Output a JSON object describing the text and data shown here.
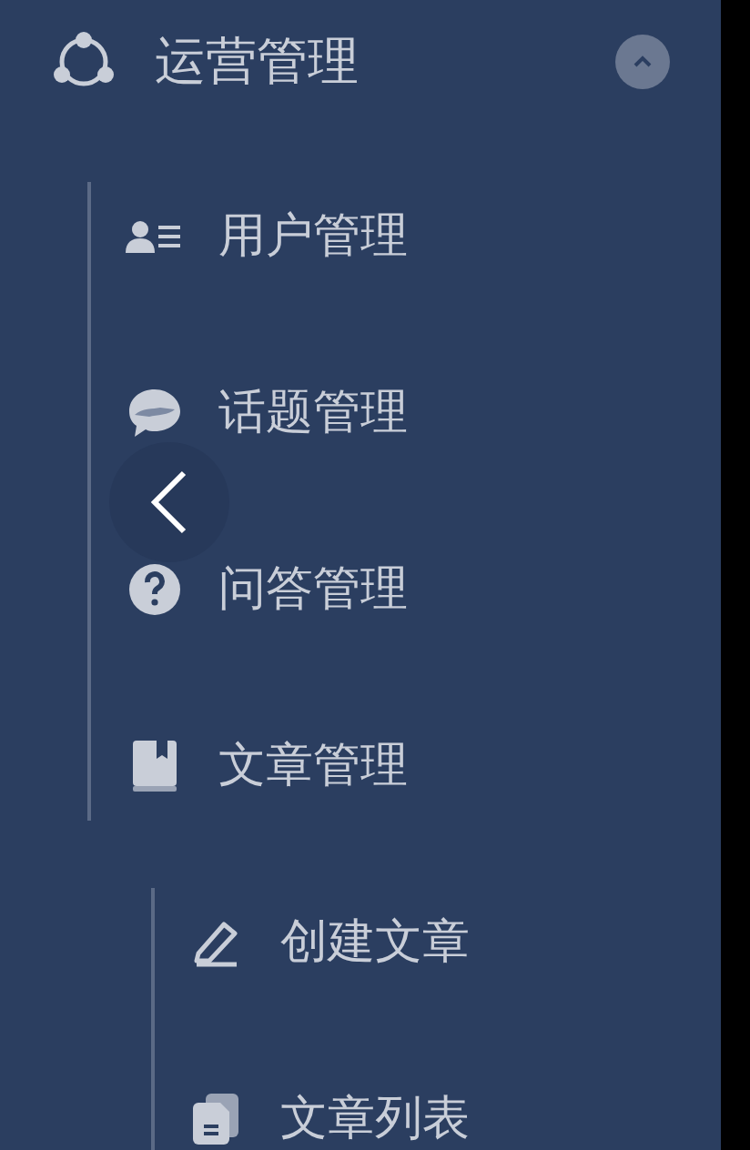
{
  "menu": {
    "title": "运营管理",
    "expanded": true,
    "children": [
      {
        "label": "用户管理"
      },
      {
        "label": "话题管理"
      },
      {
        "label": "问答管理"
      },
      {
        "label": "文章管理",
        "children": [
          {
            "label": "创建文章"
          },
          {
            "label": "文章列表"
          }
        ]
      }
    ]
  }
}
